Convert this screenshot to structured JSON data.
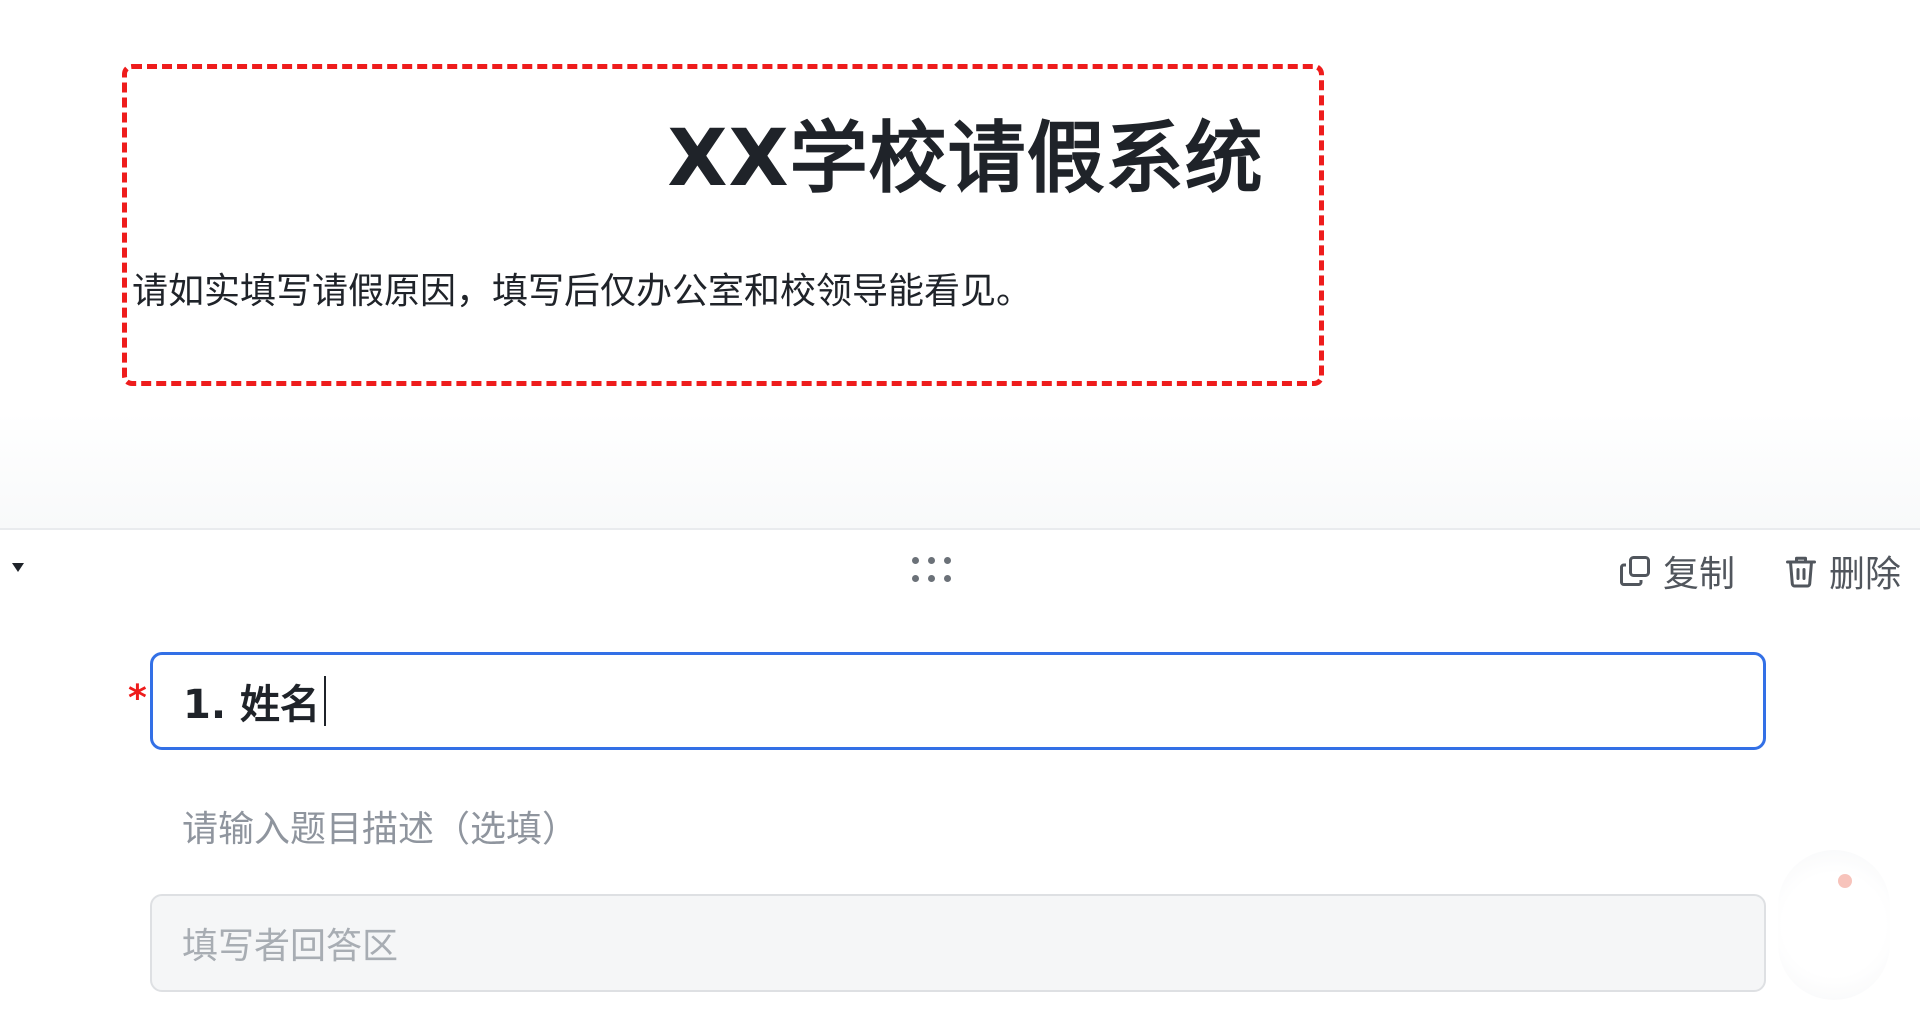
{
  "form": {
    "title": "XX学校请假系统",
    "description": "请如实填写请假原因，填写后仅办公室和校领导能看见。"
  },
  "toolbar": {
    "copy_label": "复制",
    "delete_label": "删除"
  },
  "question": {
    "required_mark": "*",
    "title": "1. 姓名",
    "description_placeholder": "请输入题目描述（选填）",
    "answer_placeholder": "填写者回答区"
  },
  "colors": {
    "required": "#ee1c1c",
    "focus_border": "#3370e6",
    "header_border": "#ee1c1c"
  }
}
